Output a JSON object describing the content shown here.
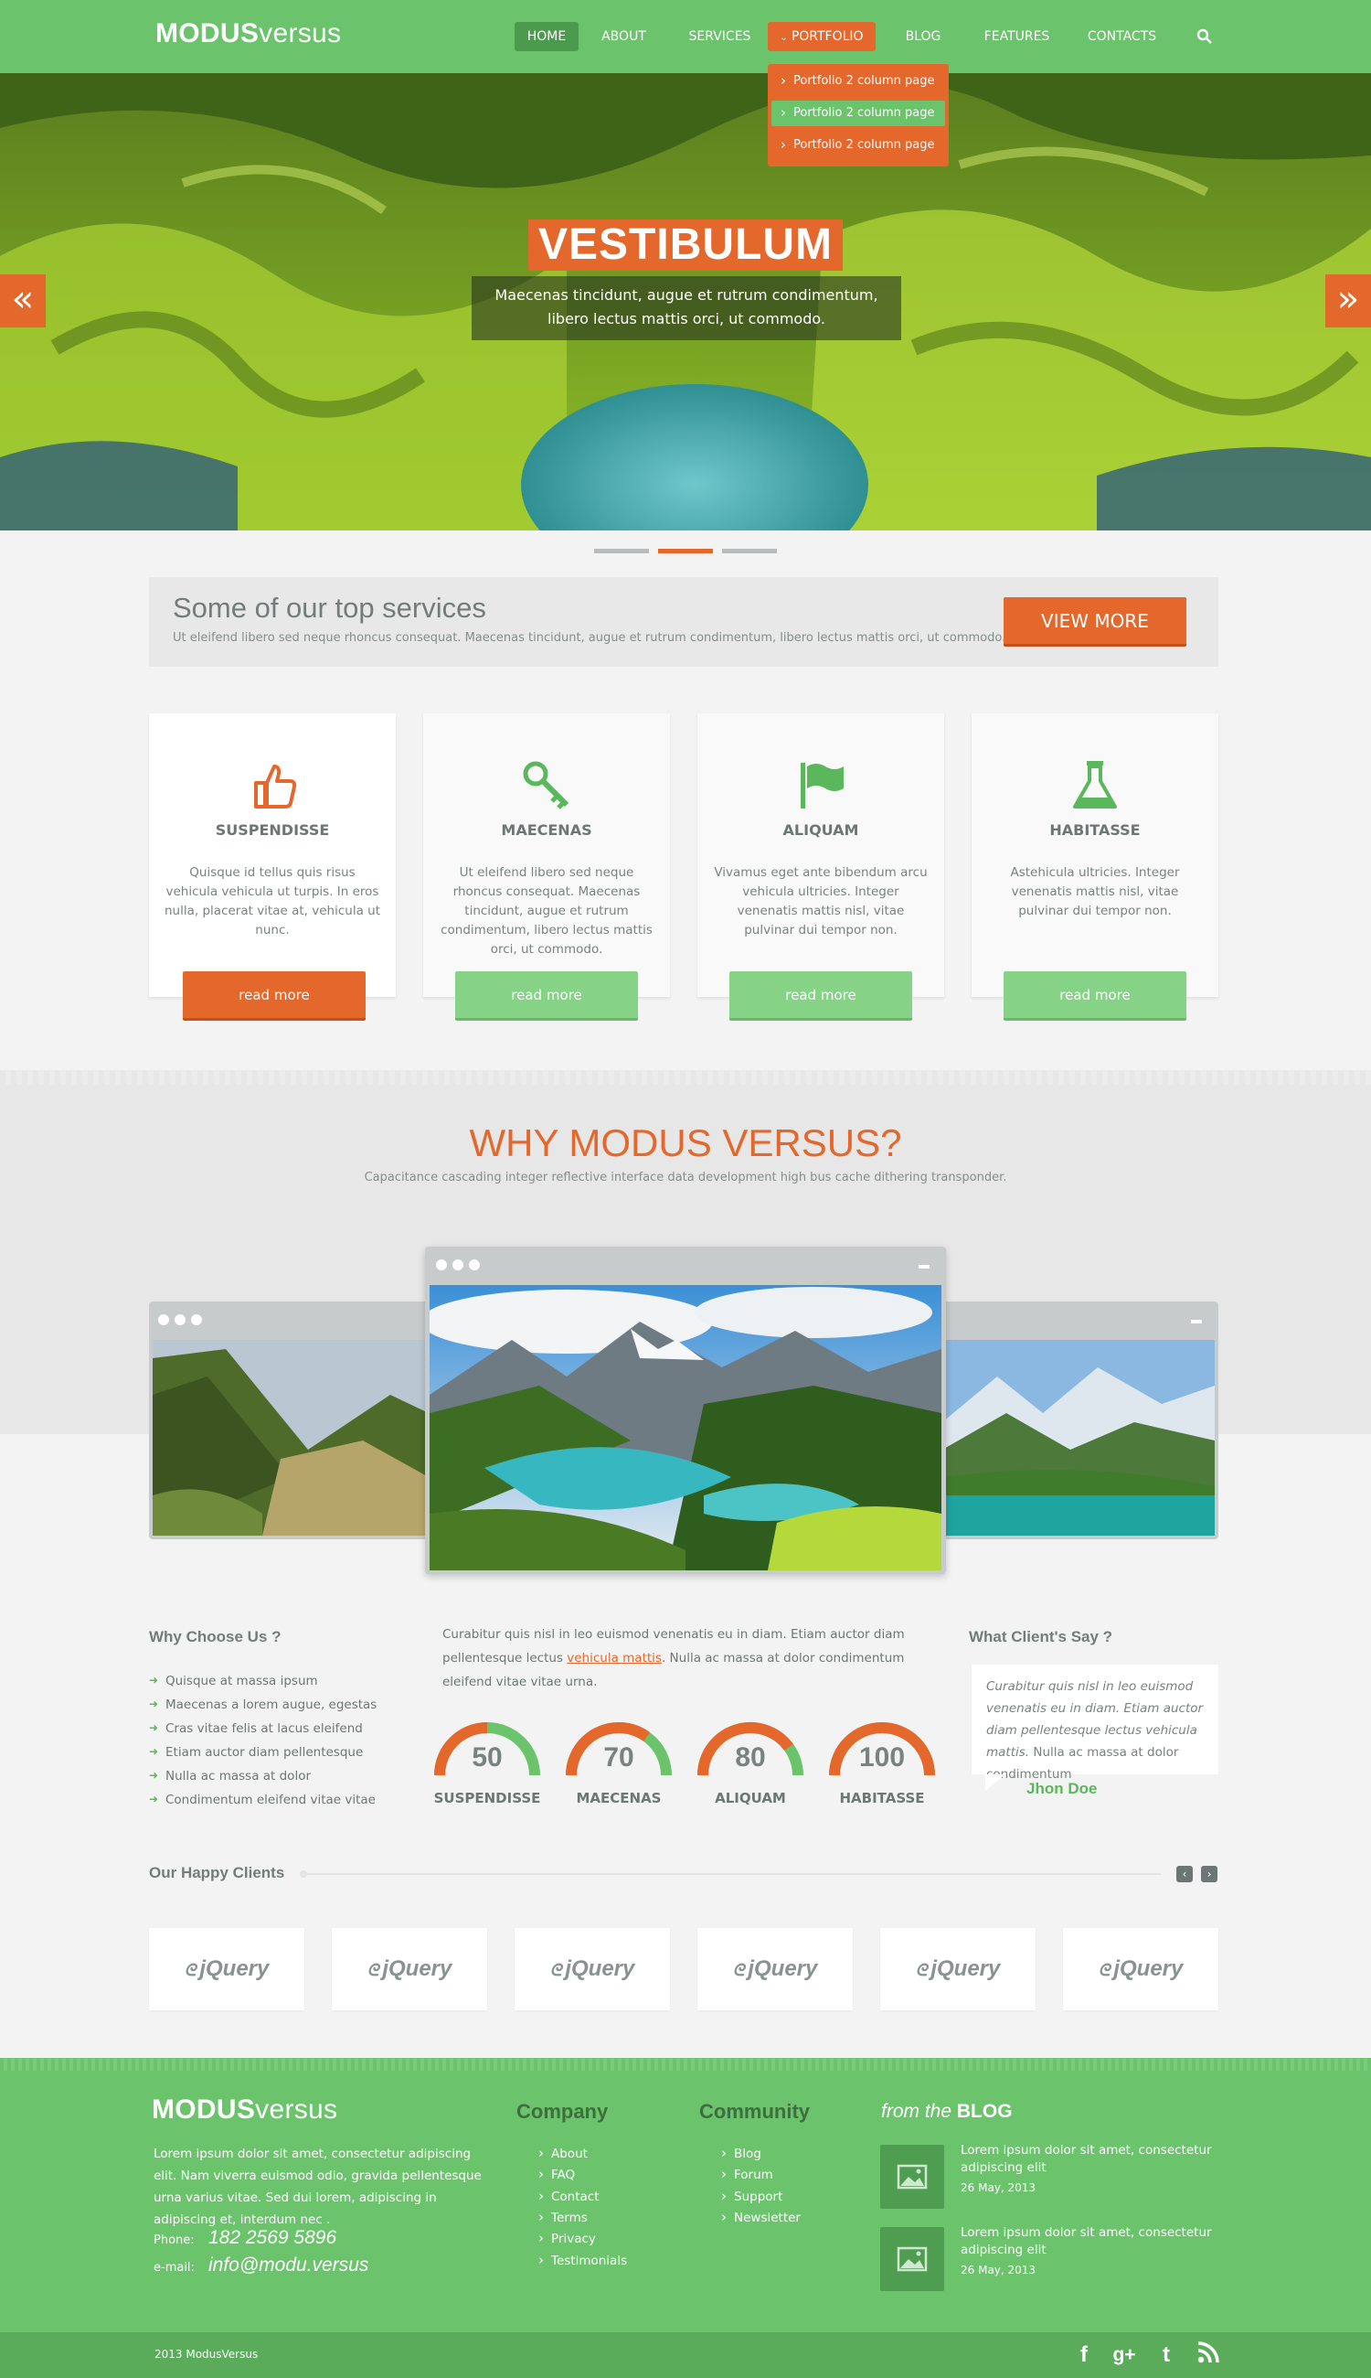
{
  "header": {
    "logo_bold": "MODUS",
    "logo_light": "versus",
    "nav": [
      "HOME",
      "ABOUT",
      "SERVICES",
      "PORTFOLIO",
      "BLOG",
      "FEATURES",
      "CONTACTS"
    ],
    "dropdown": [
      "Portfolio 2 column page",
      "Portfolio 2 column page",
      "Portfolio 2 column page"
    ]
  },
  "hero": {
    "title": "VESTIBULUM",
    "text_line1": "Maecenas tincidunt, augue et rutrum condimentum,",
    "text_line2": "libero lectus mattis orci, ut commodo.",
    "slide_count": 3,
    "active_slide": 2
  },
  "services_banner": {
    "title": "Some of our top services",
    "text": "Ut eleifend libero sed neque rhoncus consequat. Maecenas tincidunt, augue et rutrum condimentum, libero lectus mattis orci, ut commodo.",
    "button": "VIEW MORE"
  },
  "cards": [
    {
      "icon": "thumbs-up-icon",
      "title": "SUSPENDISSE",
      "text": "Quisque id tellus quis risus vehicula vehicula ut turpis. In eros nulla, placerat vitae at, vehicula ut nunc.",
      "button": "read more"
    },
    {
      "icon": "key-icon",
      "title": "MAECENAS",
      "text": "Ut eleifend libero sed neque rhoncus consequat. Maecenas tincidunt, augue et rutrum condimentum, libero lectus mattis orci, ut commodo.",
      "button": "read more"
    },
    {
      "icon": "flag-icon",
      "title": "ALIQUAM",
      "text": "Vivamus eget ante bibendum arcu vehicula ultricies. Integer venenatis mattis nisl, vitae pulvinar dui tempor non.",
      "button": "read more"
    },
    {
      "icon": "flask-icon",
      "title": "HABITASSE",
      "text": "Astehicula ultricies. Integer venenatis mattis nisl, vitae pulvinar dui tempor non.",
      "button": "read more"
    }
  ],
  "why": {
    "title": "WHY MODUS VERSUS?",
    "subtitle": "Capacitance cascading integer reflective interface data development high bus cache dithering transponder."
  },
  "why_choose": {
    "title": "Why Choose Us ?",
    "items": [
      "Quisque at massa ipsum",
      "Maecenas a lorem augue, egestas",
      "Cras vitae felis at lacus eleifend",
      "Etiam auctor diam pellentesque",
      "Nulla ac massa at dolor",
      "Condimentum eleifend vitae vitae"
    ]
  },
  "middle": {
    "text_a": "Curabitur quis nisl in leo euismod venenatis eu in diam. Etiam auctor diam pellentesque lectus ",
    "link": "vehicula mattis",
    "text_b": ". Nulla ac massa at dolor condimentum eleifend vitae vitae urna."
  },
  "gauges": [
    {
      "value": 50,
      "label": "SUSPENDISSE"
    },
    {
      "value": 70,
      "label": "MAECENAS"
    },
    {
      "value": 80,
      "label": "ALIQUAM"
    },
    {
      "value": 100,
      "label": "HABITASSE"
    }
  ],
  "testimonial": {
    "title": "What Client's Say ?",
    "quote_italic": "Curabitur quis nisl in leo euismod venenatis eu in diam. Etiam auctor diam pellentesque lectus vehicula mattis.",
    "quote_plain": " Nulla ac massa at dolor condimentum",
    "author": "Jhon Doe"
  },
  "clients": {
    "title": "Our Happy Clients",
    "logos": [
      "jQuery",
      "jQuery",
      "jQuery",
      "jQuery",
      "jQuery",
      "jQuery"
    ]
  },
  "footer": {
    "logo_bold": "MODUS",
    "logo_light": "versus",
    "about": "Lorem ipsum dolor sit amet, consectetur adipiscing elit. Nam viverra euismod odio, gravida pellentesque urna varius vitae. Sed dui lorem, adipiscing in adipiscing et, interdum nec .",
    "phone_label": "Phone:",
    "phone": "182 2569 5896",
    "email_label": "e-mail:",
    "email": "info@modu.versus",
    "company_title": "Company",
    "company_links": [
      "About",
      "FAQ",
      "Contact",
      "Terms",
      "Privacy",
      "Testimonials"
    ],
    "community_title": "Community",
    "community_links": [
      "Blog",
      "Forum",
      "Support",
      "Newsletter"
    ],
    "blog_prefix": "from the",
    "blog_title": "BLOG",
    "posts": [
      {
        "title": "Lorem ipsum dolor sit amet, consectetur adipiscing elit",
        "date": "26 May, 2013"
      },
      {
        "title": "Lorem ipsum dolor sit amet, consectetur adipiscing elit",
        "date": "26 May, 2013"
      }
    ],
    "copyright": "2013  ModusVersus",
    "social": [
      "facebook-icon",
      "google-plus-icon",
      "twitter-icon",
      "rss-icon"
    ]
  },
  "colors": {
    "green": "#6bc46c",
    "orange": "#e4672c",
    "gray_text": "#6d7675"
  }
}
